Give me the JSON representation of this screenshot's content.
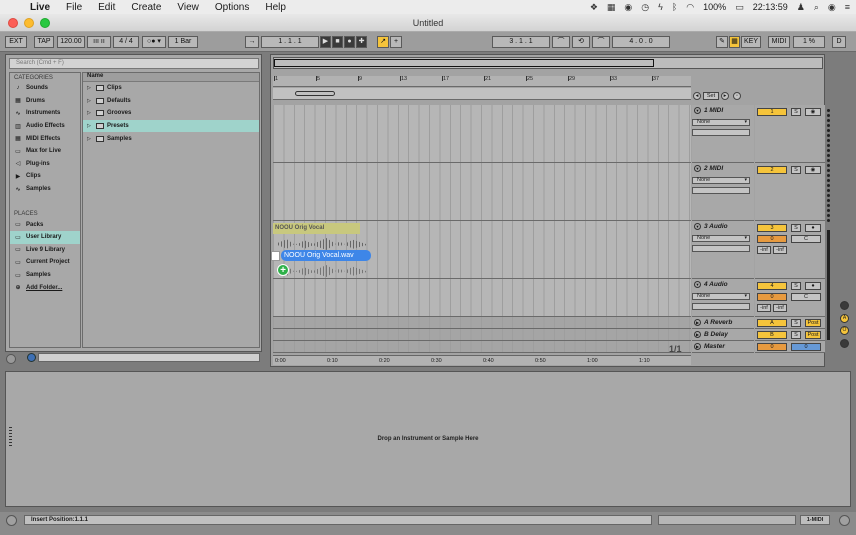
{
  "menubar": {
    "app": "Live",
    "items": [
      "File",
      "Edit",
      "Create",
      "View",
      "Options",
      "Help"
    ],
    "battery": "100%",
    "time": "22:13:59"
  },
  "window": {
    "title": "Untitled"
  },
  "transport": {
    "ext": "EXT",
    "tap": "TAP",
    "tempo": "120.00",
    "signature": "4 / 4",
    "quantize": "1 Bar",
    "position": "1 .   1 .   1",
    "loop_start": "3 .   1 .   1",
    "loop_length": "4 .   0 .   0",
    "key": "KEY",
    "midi": "MIDI",
    "cpu": "1 %",
    "disk": "D"
  },
  "browser": {
    "search_placeholder": "Search (Cmd + F)",
    "categories_label": "CATEGORIES",
    "categories": [
      {
        "label": "Sounds",
        "icon": "♪"
      },
      {
        "label": "Drums",
        "icon": "▦"
      },
      {
        "label": "Instruments",
        "icon": "∿"
      },
      {
        "label": "Audio Effects",
        "icon": "▥"
      },
      {
        "label": "MIDI Effects",
        "icon": "▦"
      },
      {
        "label": "Max for Live",
        "icon": "▭"
      },
      {
        "label": "Plug-ins",
        "icon": "◁"
      },
      {
        "label": "Clips",
        "icon": "▶"
      },
      {
        "label": "Samples",
        "icon": "∿"
      }
    ],
    "places_label": "PLACES",
    "places": [
      {
        "label": "Packs",
        "icon": "▭"
      },
      {
        "label": "User Library",
        "icon": "▭",
        "selected": true
      },
      {
        "label": "Live 9 Library",
        "icon": "▭"
      },
      {
        "label": "Current Project",
        "icon": "▭"
      },
      {
        "label": "Samples",
        "icon": "▭"
      },
      {
        "label": "Add Folder...",
        "icon": "⊕"
      }
    ],
    "name_header": "Name",
    "folders": [
      {
        "label": "Clips"
      },
      {
        "label": "Defaults"
      },
      {
        "label": "Grooves"
      },
      {
        "label": "Presets",
        "selected": true
      },
      {
        "label": "Samples"
      }
    ]
  },
  "arrangement": {
    "ruler_ticks": [
      "1",
      "5",
      "9",
      "13",
      "17",
      "21",
      "25",
      "29",
      "33",
      "37"
    ],
    "time_ticks": [
      "0:00",
      "0:10",
      "0:20",
      "0:30",
      "0:40",
      "0:50",
      "1:00",
      "1:10"
    ],
    "set_label": "Set",
    "clip_label": "NOOU Orig Vocal",
    "dragged_file": "NOOU Orig Vocal.wav",
    "page_fraction": "1/1"
  },
  "tracks": [
    {
      "name": "1 MIDI",
      "input": "None",
      "number": "1",
      "kind": "midi"
    },
    {
      "name": "2 MIDI",
      "input": "None",
      "number": "2",
      "kind": "midi"
    },
    {
      "name": "3 Audio",
      "input": "None",
      "number": "3",
      "kind": "audio",
      "pan": "0",
      "pan_c": "C",
      "vol": "-inf",
      "vol2": "-inf"
    },
    {
      "name": "4 Audio",
      "input": "None",
      "number": "4",
      "kind": "audio",
      "pan": "0",
      "pan_c": "C",
      "vol": "-inf",
      "vol2": "-inf"
    }
  ],
  "returns": [
    {
      "name": "A Reverb",
      "letter": "A",
      "post": "Post"
    },
    {
      "name": "B Delay",
      "letter": "B",
      "post": "Post"
    },
    {
      "name": "Master",
      "letter": "0",
      "post": "0"
    }
  ],
  "mixer": {
    "solo": "S"
  },
  "detail": {
    "drop_text": "Drop an Instrument or Sample Here"
  },
  "status": {
    "message": "Insert Position:1.1.1",
    "midi_track": "1-MIDI"
  },
  "colors": {
    "accent": "#f5c43b",
    "selection": "#9fd3cb",
    "drag": "#3e86e8"
  }
}
